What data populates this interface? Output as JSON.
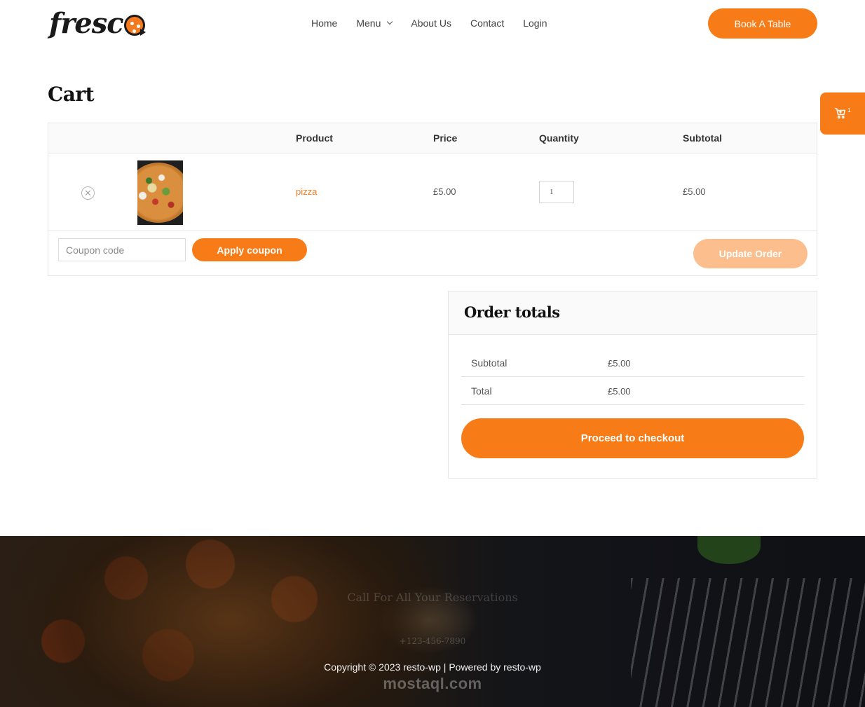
{
  "header": {
    "logo_text": "fresc",
    "nav": [
      {
        "label": "Home"
      },
      {
        "label": "Menu"
      },
      {
        "label": "About Us"
      },
      {
        "label": "Contact"
      },
      {
        "label": "Login"
      }
    ],
    "cta_label": "Book A Table"
  },
  "side_cart": {
    "count": "1"
  },
  "page_title": "Cart",
  "cart": {
    "columns": [
      "Product",
      "Price",
      "Quantity",
      "Subtotal"
    ],
    "items": [
      {
        "name": "pizza",
        "price": "£5.00",
        "quantity": "1",
        "subtotal": "£5.00"
      }
    ],
    "coupon_placeholder": "Coupon code",
    "apply_label": "Apply coupon",
    "update_label": "Update Order"
  },
  "totals": {
    "title": "Order totals",
    "rows": [
      {
        "label": "Subtotal",
        "value": "£5.00"
      },
      {
        "label": "Total",
        "value": "£5.00"
      }
    ],
    "checkout_label": "Proceed to checkout"
  },
  "footer": {
    "reservations": "Call For All Your Reservations",
    "phone": "+123-456-7890",
    "copyright": "Copyright © 2023 resto-wp | Powered by resto-wp",
    "watermark": "mostaql.com"
  },
  "colors": {
    "accent": "#f77b16",
    "accent_light": "#fbbe8c",
    "link": "#f47a1f"
  }
}
